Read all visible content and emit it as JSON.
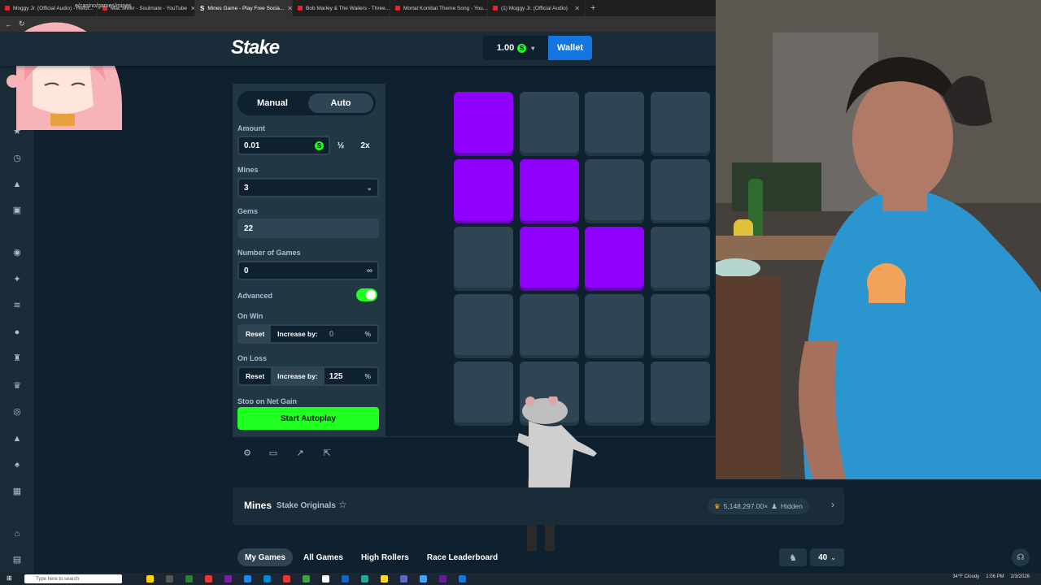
{
  "browser": {
    "tabs": [
      {
        "label": "Moggy Jr. (Official Audio) - Refor...",
        "active": false
      },
      {
        "label": "Mac Miller - Soulmate - YouTube",
        "active": false
      },
      {
        "label": "Mines Game - Play Free Socia...",
        "active": true
      },
      {
        "label": "Bob Marley & The Wailers - Three...",
        "active": false
      },
      {
        "label": "Mortal Kombat Theme Song - You...",
        "active": false
      },
      {
        "label": "(1) Moggy Jr. (Official Audio)",
        "active": false
      }
    ],
    "url": "e/casino/games/mines"
  },
  "header": {
    "logo": "Stake",
    "balance": "1.00",
    "coin_symbol": "S",
    "wallet_label": "Wallet"
  },
  "bet_panel": {
    "mode_manual": "Manual",
    "mode_auto": "Auto",
    "selected_mode": "Auto",
    "amount_label": "Amount",
    "amount_value": "0.01",
    "half_label": "½",
    "double_label": "2x",
    "mines_label": "Mines",
    "mines_value": "3",
    "gems_label": "Gems",
    "gems_value": "22",
    "num_games_label": "Number of Games",
    "num_games_value": "0",
    "infinity_symbol": "∞",
    "advanced_label": "Advanced",
    "advanced_on": true,
    "on_win_label": "On Win",
    "on_win_reset": "Reset",
    "on_win_increase": "Increase by:",
    "on_win_value": "0",
    "on_loss_label": "On Loss",
    "on_loss_reset": "Reset",
    "on_loss_increase": "Increase by:",
    "on_loss_value": "125",
    "percent": "%",
    "stop_label": "Stop on Net Gain",
    "start_button": "Start Autoplay"
  },
  "grid": {
    "gem_tiles": [
      0,
      4,
      5,
      9,
      10
    ]
  },
  "game_info": {
    "name": "Mines",
    "provider": "Stake Originals",
    "stat": "5,148,297.00×",
    "hidden": "Hidden"
  },
  "bottom_tabs": [
    "My Games",
    "All Games",
    "High Rollers",
    "Race Leaderboard"
  ],
  "rows_count": "40",
  "taskbar": {
    "search_placeholder": "Type here to search",
    "weather": "34°F Cloudy",
    "time": "1:06 PM",
    "date": "2/3/2026"
  },
  "colors": {
    "gem": "#9000ff",
    "accent_green": "#1fff20",
    "wallet_blue": "#1475e1",
    "tile": "#2f4553"
  }
}
